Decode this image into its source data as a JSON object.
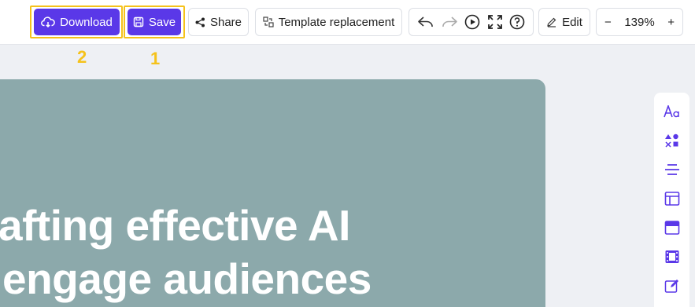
{
  "toolbar": {
    "download_label": "Download",
    "save_label": "Save",
    "share_label": "Share",
    "template_label": "Template replacement",
    "edit_label": "Edit",
    "zoom_value": "139%",
    "zoom_minus": "−",
    "zoom_plus": "+"
  },
  "annotations": {
    "marker_download": "2",
    "marker_save": "1"
  },
  "canvas": {
    "line1": "afting effective AI",
    "line2": "engage audiences"
  },
  "right_panel": {
    "icons": [
      "text-style-icon",
      "elements-icon",
      "align-icon",
      "layout-icon",
      "background-icon",
      "media-icon",
      "edit-pen-icon"
    ]
  },
  "colors": {
    "accent": "#5a38e8",
    "highlight": "#f5c21b",
    "canvas_bg": "#8ca9ab",
    "page_bg": "#eef0f4"
  }
}
